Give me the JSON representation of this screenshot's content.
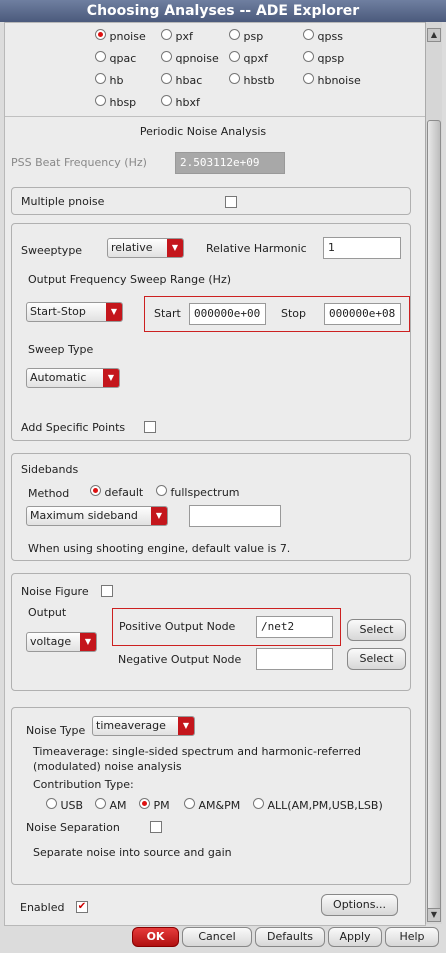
{
  "window": {
    "title": "Choosing Analyses -- ADE Explorer"
  },
  "analyses": {
    "options": [
      "pnoise",
      "pxf",
      "psp",
      "qpss",
      "qpac",
      "qpnoise",
      "qpxf",
      "qpsp",
      "hb",
      "hbac",
      "hbstb",
      "hbnoise",
      "hbsp",
      "hbxf"
    ],
    "selected": "pnoise"
  },
  "section_title": "Periodic Noise Analysis",
  "pss_beat": {
    "label": "PSS Beat Frequency (Hz)",
    "value": "2.503112e+09"
  },
  "multiple_pnoise": {
    "label": "Multiple pnoise",
    "checked": false
  },
  "sweep": {
    "sweeptype_label": "Sweeptype",
    "sweeptype_value": "relative",
    "rel_harmonic_label": "Relative Harmonic",
    "rel_harmonic_value": "1",
    "range_label": "Output Frequency Sweep Range (Hz)",
    "range_mode": "Start-Stop",
    "start_label": "Start",
    "start_value": "000000e+00",
    "stop_label": "Stop",
    "stop_value": "000000e+08",
    "sweep_type_label": "Sweep Type",
    "sweep_type_value": "Automatic",
    "add_points_label": "Add Specific Points"
  },
  "sidebands": {
    "title": "Sidebands",
    "method_label": "Method",
    "method_default": "default",
    "method_full": "fullspectrum",
    "combo_value": "Maximum sideband",
    "note": "When using shooting engine, default value is 7."
  },
  "noise_figure": {
    "label": "Noise Figure",
    "output_label": "Output",
    "output_value": "voltage",
    "pos_label": "Positive Output Node",
    "pos_value": "/net2",
    "neg_label": "Negative Output Node",
    "neg_value": "",
    "select_label": "Select"
  },
  "noise_type": {
    "label": "Noise Type",
    "value": "timeaverage",
    "desc_line1": "Timeaverage: single-sided spectrum and harmonic-referred",
    "desc_line2": "(modulated) noise analysis",
    "contrib_label": "Contribution Type:",
    "contrib_options": [
      "USB",
      "AM",
      "PM",
      "AM&PM",
      "ALL(AM,PM,USB,LSB)"
    ],
    "contrib_selected": "PM",
    "separation_label": "Noise Separation",
    "separation_note": "Separate noise into source and gain"
  },
  "footer": {
    "enabled_label": "Enabled",
    "options_label": "Options...",
    "ok": "OK",
    "cancel": "Cancel",
    "defaults": "Defaults",
    "apply": "Apply",
    "help": "Help"
  }
}
